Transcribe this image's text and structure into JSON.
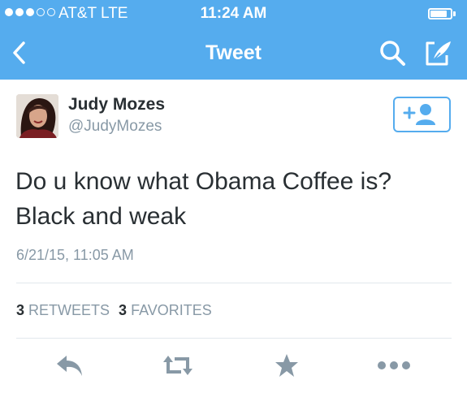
{
  "status_bar": {
    "carrier": "AT&T",
    "network": "LTE",
    "time": "11:24 AM",
    "signal_bars": 3,
    "signal_total": 5,
    "battery_level": 0.85
  },
  "nav": {
    "title": "Tweet",
    "icons": {
      "back": "chevron-left-icon",
      "search": "search-icon",
      "compose": "compose-icon"
    }
  },
  "tweet": {
    "display_name": "Judy Mozes",
    "handle": "@JudyMozes",
    "text_line1": "Do u know what Obama Coffee is?",
    "text_line2": "Black and weak",
    "timestamp": "6/21/15, 11:05 AM",
    "retweets_count": "3",
    "retweets_label": "RETWEETS",
    "favorites_count": "3",
    "favorites_label": "FAVORITES"
  },
  "actions": {
    "icons": [
      "reply-icon",
      "retweet-icon",
      "favorite-star-icon",
      "more-dots-icon"
    ]
  },
  "colors": {
    "brand": "#55acee",
    "text": "#292f33",
    "muted": "#8899a6",
    "icon_gray": "#8899a6",
    "divider": "#e1e8ed"
  }
}
